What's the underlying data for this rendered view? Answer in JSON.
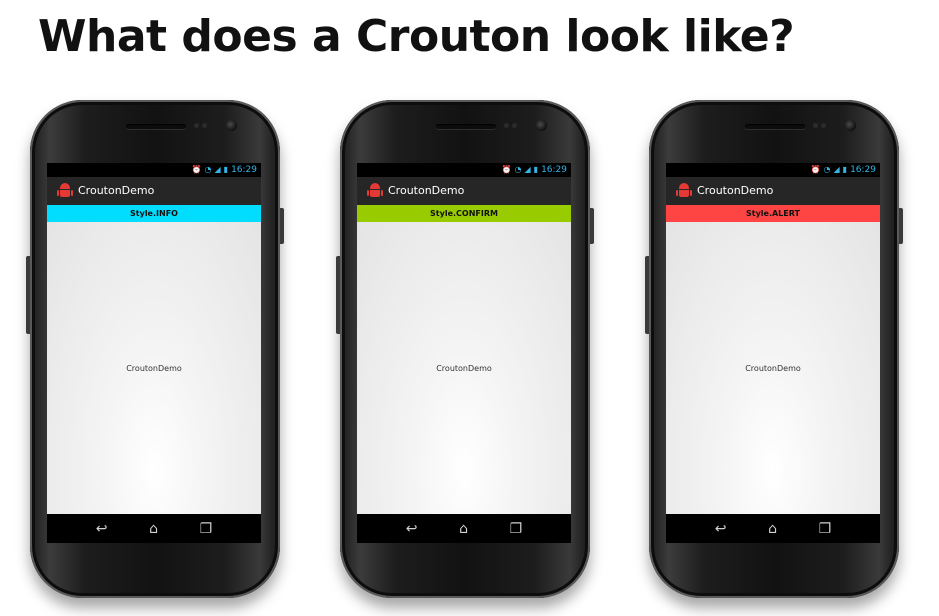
{
  "heading": "What does a Crouton look like?",
  "phones": [
    {
      "status_time": "16:29",
      "app_name": "CroutonDemo",
      "crouton_text": "Style.INFO",
      "crouton_color": "#00ddff",
      "content_text": "CroutonDemo"
    },
    {
      "status_time": "16:29",
      "app_name": "CroutonDemo",
      "crouton_text": "Style.CONFIRM",
      "crouton_color": "#99cc00",
      "content_text": "CroutonDemo"
    },
    {
      "status_time": "16:29",
      "app_name": "CroutonDemo",
      "crouton_text": "Style.ALERT",
      "crouton_color": "#ff4444",
      "content_text": "CroutonDemo"
    }
  ],
  "status_icons": [
    "alarm-icon",
    "wifi-icon",
    "signal-icon",
    "battery-icon"
  ],
  "nav_icons": [
    "back-icon",
    "home-icon",
    "recent-apps-icon"
  ],
  "colors": {
    "status_text": "#33b5e5",
    "action_bar": "#262626",
    "app_icon": "#e53935"
  }
}
